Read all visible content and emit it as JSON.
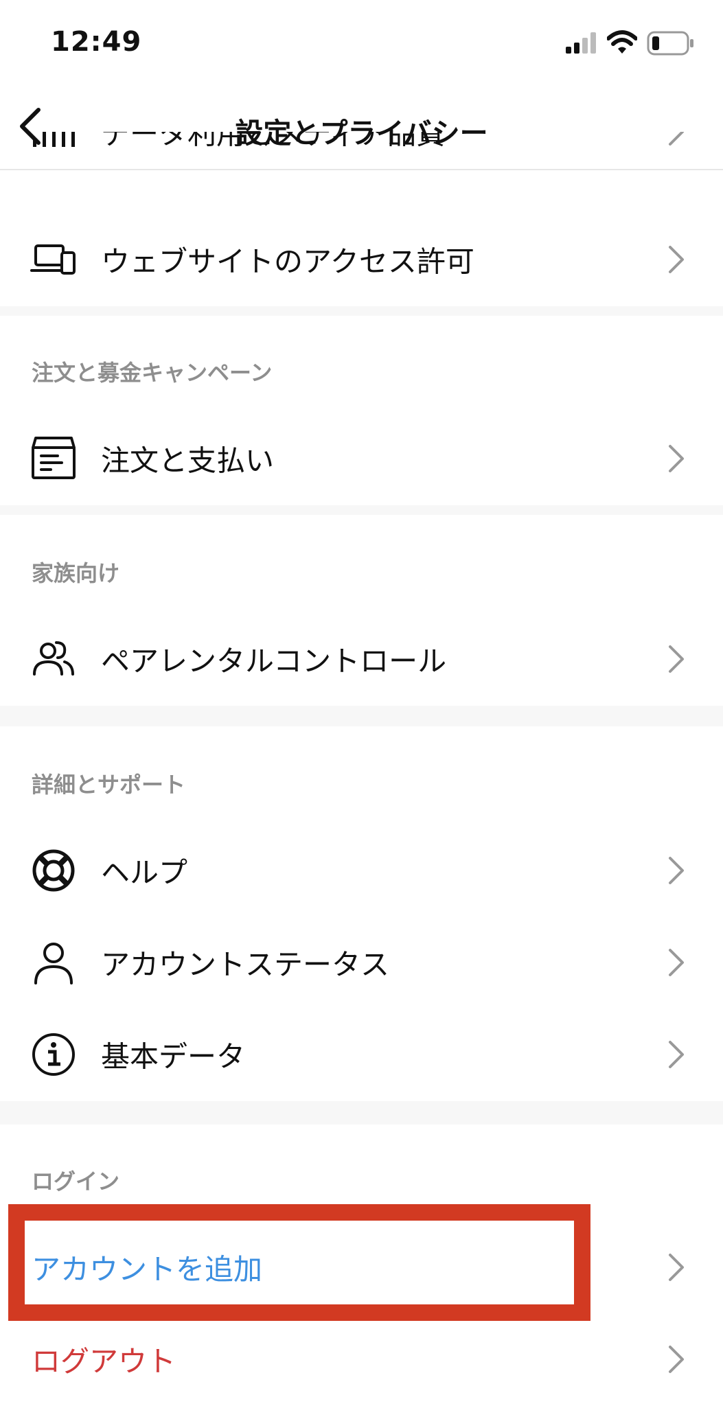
{
  "status_bar": {
    "time": "12:49"
  },
  "header": {
    "title": "設定とプライバシー"
  },
  "rows": {
    "data_usage": "データ利用とメディア品質",
    "website_access": "ウェブサイトのアクセス許可",
    "orders": "注文と支払い",
    "parental": "ペアレンタルコントロール",
    "help": "ヘルプ",
    "account_status": "アカウントステータス",
    "basic_data": "基本データ",
    "add_account": "アカウントを追加",
    "logout": "ログアウト"
  },
  "sections": {
    "orders": "注文と募金キャンペーン",
    "family": "家族向け",
    "support": "詳細とサポート",
    "login": "ログイン"
  },
  "colors": {
    "link_blue": "#3d8fe0",
    "logout_red": "#d03a3a",
    "highlight_red": "#d23a22",
    "section_gray": "#8e8e8e"
  }
}
